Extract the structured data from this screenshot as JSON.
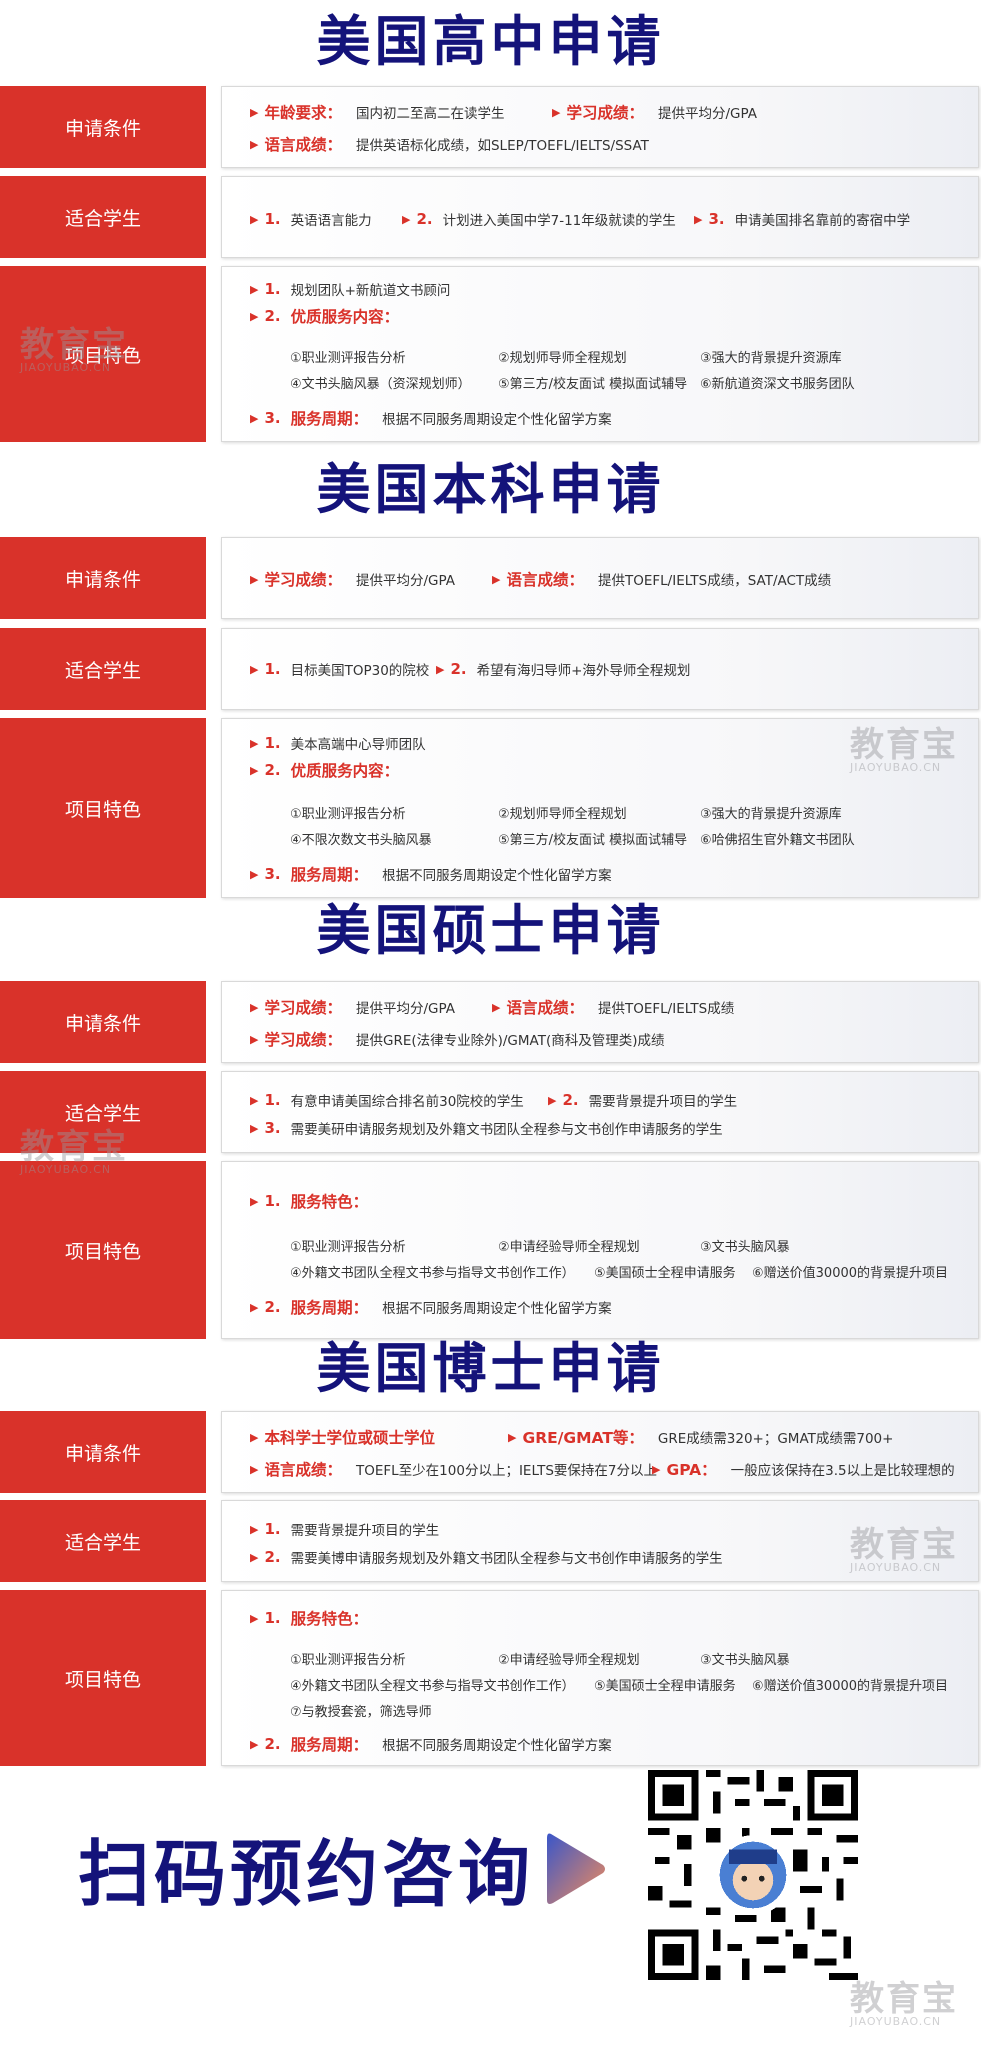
{
  "sections": [
    {
      "title": "美国高中申请",
      "rows": [
        {
          "label": "申请条件",
          "lines": [
            {
              "key": "年龄要求：",
              "text": "国内初二至高二在读学生",
              "key2": "学习成绩：",
              "text2": "提供平均分/GPA"
            },
            {
              "key": "语言成绩：",
              "text": "提供英语标化成绩，如SLEP/TOEFL/IELTS/SSAT"
            }
          ]
        },
        {
          "label": "适合学生",
          "items": [
            {
              "num": "1.",
              "text": "英语语言能力"
            },
            {
              "num": "2.",
              "text": "计划进入美国中学7-11年级就读的学生"
            },
            {
              "num": "3.",
              "text": "申请美国排名靠前的寄宿中学"
            }
          ]
        },
        {
          "label": "项目特色",
          "p1": {
            "num": "1.",
            "text": "规划团队+新航道文书顾问"
          },
          "p2": {
            "num": "2.",
            "text": "优质服务内容："
          },
          "services": [
            "①职业测评报告分析",
            "②规划师导师全程规划",
            "③强大的背景提升资源库",
            "④文书头脑风暴（资深规划师）",
            "⑤第三方/校友面试 模拟面试辅导",
            "⑥新航道资深文书服务团队"
          ],
          "p3": {
            "num": "3.",
            "key": "服务周期：",
            "text": "根据不同服务周期设定个性化留学方案"
          }
        }
      ]
    },
    {
      "title": "美国本科申请",
      "rows": [
        {
          "label": "申请条件",
          "lines": [
            {
              "key": "学习成绩：",
              "text": "提供平均分/GPA",
              "key2": "语言成绩：",
              "text2": "提供TOEFL/IELTS成绩，SAT/ACT成绩"
            }
          ]
        },
        {
          "label": "适合学生",
          "items": [
            {
              "num": "1.",
              "text": "目标美国TOP30的院校"
            },
            {
              "num": "2.",
              "text": "希望有海归导师+海外导师全程规划"
            }
          ]
        },
        {
          "label": "项目特色",
          "p1": {
            "num": "1.",
            "text": "美本高端中心导师团队"
          },
          "p2": {
            "num": "2.",
            "text": "优质服务内容："
          },
          "services": [
            "①职业测评报告分析",
            "②规划师导师全程规划",
            "③强大的背景提升资源库",
            "④不限次数文书头脑风暴",
            "⑤第三方/校友面试 模拟面试辅导",
            "⑥哈佛招生官外籍文书团队"
          ],
          "p3": {
            "num": "3.",
            "key": "服务周期：",
            "text": "根据不同服务周期设定个性化留学方案"
          }
        }
      ]
    },
    {
      "title": "美国硕士申请",
      "rows": [
        {
          "label": "申请条件",
          "lines": [
            {
              "key": "学习成绩：",
              "text": "提供平均分/GPA",
              "key2": "语言成绩：",
              "text2": "提供TOEFL/IELTS成绩"
            },
            {
              "key": "学习成绩：",
              "text": "提供GRE(法律专业除外)/GMAT(商科及管理类)成绩"
            }
          ]
        },
        {
          "label": "适合学生",
          "items": [
            {
              "num": "1.",
              "text": "有意申请美国综合排名前30院校的学生"
            },
            {
              "num": "2.",
              "text": "需要背景提升项目的学生"
            },
            {
              "num": "3.",
              "text": "需要美研申请服务规划及外籍文书团队全程参与文书创作申请服务的学生"
            }
          ]
        },
        {
          "label": "项目特色",
          "p1": {
            "num": "1.",
            "text": "服务特色："
          },
          "services": [
            "①职业测评报告分析",
            "②申请经验导师全程规划",
            "③文书头脑风暴",
            "④外籍文书团队全程文书参与指导文书创作工作）",
            "⑤美国硕士全程申请服务",
            "⑥赠送价值30000的背景提升项目"
          ],
          "p3": {
            "num": "2.",
            "key": "服务周期：",
            "text": "根据不同服务周期设定个性化留学方案"
          }
        }
      ]
    },
    {
      "title": "美国博士申请",
      "rows": [
        {
          "label": "申请条件",
          "lines": [
            {
              "key": "本科学士学位或硕士学位",
              "text": "",
              "key2": "GRE/GMAT等：",
              "text2": "GRE成绩需320+；GMAT成绩需700+"
            },
            {
              "key": "语言成绩：",
              "text": "TOEFL至少在100分以上；IELTS要保持在7分以上",
              "key2": "GPA：",
              "text2": "一般应该保持在3.5以上是比较理想的"
            }
          ]
        },
        {
          "label": "适合学生",
          "items": [
            {
              "num": "1.",
              "text": "需要背景提升项目的学生"
            },
            {
              "num": "2.",
              "text": "需要美博申请服务规划及外籍文书团队全程参与文书创作申请服务的学生"
            }
          ]
        },
        {
          "label": "项目特色",
          "p1": {
            "num": "1.",
            "text": "服务特色："
          },
          "services": [
            "①职业测评报告分析",
            "②申请经验导师全程规划",
            "③文书头脑风暴",
            "④外籍文书团队全程文书参与指导文书创作工作）",
            "⑤美国硕士全程申请服务",
            "⑥赠送价值30000的背景提升项目",
            "⑦与教授套瓷，筛选导师"
          ],
          "p3": {
            "num": "2.",
            "key": "服务周期：",
            "text": "根据不同服务周期设定个性化留学方案"
          }
        }
      ]
    }
  ],
  "cta": {
    "text": "扫码预约咨询"
  },
  "watermark": {
    "cn": "教育宝",
    "en": "JIAOYUBAO.CN"
  },
  "colors": {
    "red": "#d9322a",
    "navy": "#14137a"
  }
}
